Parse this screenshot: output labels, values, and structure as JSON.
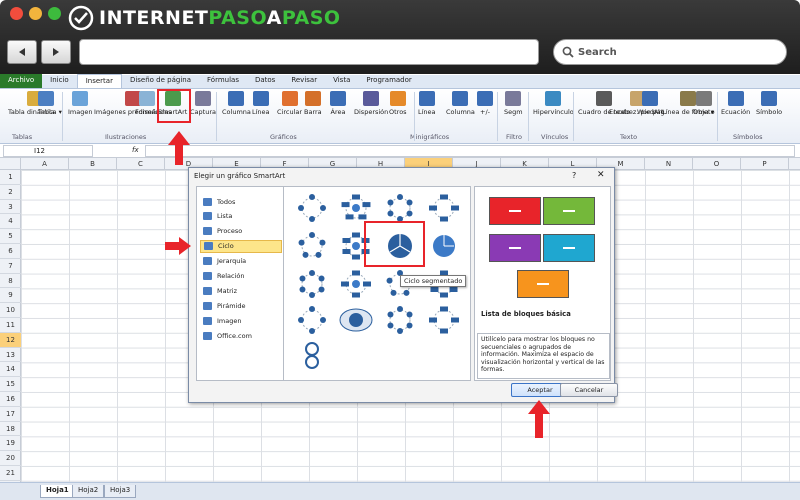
{
  "browser": {
    "logo_text_a": "INTERNET",
    "logo_text_b": "PASO",
    "logo_text_c": "A",
    "logo_text_d": "PASO",
    "search_label": "Search"
  },
  "ribbon": {
    "tabs": [
      "Archivo",
      "Inicio",
      "Insertar",
      "Diseño de página",
      "Fórmulas",
      "Datos",
      "Revisar",
      "Vista",
      "Programador"
    ],
    "buttons": [
      {
        "label": "Tabla dinámica ▾",
        "icon": "pivot-table-icon"
      },
      {
        "label": "Tabla",
        "icon": "table-icon"
      },
      {
        "label": "Imagen",
        "icon": "image-icon"
      },
      {
        "label": "Imágenes prediseñadas",
        "icon": "clipart-icon"
      },
      {
        "label": "Formas",
        "icon": "shapes-icon"
      },
      {
        "label": "SmartArt",
        "icon": "smartart-icon"
      },
      {
        "label": "Captura",
        "icon": "screenshot-icon"
      },
      {
        "label": "Columna",
        "icon": "column-chart-icon"
      },
      {
        "label": "Línea",
        "icon": "line-chart-icon"
      },
      {
        "label": "Circular",
        "icon": "pie-chart-icon"
      },
      {
        "label": "Barra",
        "icon": "bar-chart-icon"
      },
      {
        "label": "Área",
        "icon": "area-chart-icon"
      },
      {
        "label": "Dispersión",
        "icon": "scatter-chart-icon"
      },
      {
        "label": "Otros",
        "icon": "other-charts-icon"
      },
      {
        "label": "Línea",
        "icon": "sparkline-line-icon"
      },
      {
        "label": "Columna",
        "icon": "sparkline-column-icon"
      },
      {
        "label": "+/-",
        "icon": "sparkline-winloss-icon"
      },
      {
        "label": "Segm",
        "icon": "slicer-icon"
      },
      {
        "label": "Hipervínculo",
        "icon": "hyperlink-icon"
      },
      {
        "label": "Cuadro de texto",
        "icon": "textbox-icon"
      },
      {
        "label": "Encabez. pie pág.",
        "icon": "header-footer-icon"
      },
      {
        "label": "WordArt",
        "icon": "wordart-icon"
      },
      {
        "label": "Línea de firma ▾",
        "icon": "signature-line-icon"
      },
      {
        "label": "Objeto",
        "icon": "object-icon"
      },
      {
        "label": "Ecuación",
        "icon": "equation-icon"
      },
      {
        "label": "Símbolo",
        "icon": "symbol-icon"
      }
    ],
    "groups": [
      "Tablas",
      "Ilustraciones",
      "Gráficos",
      "Minigráficos",
      "Filtro",
      "Vínculos",
      "Texto",
      "Símbolos"
    ]
  },
  "formula_bar": {
    "name_box": "I12",
    "fx": "fx"
  },
  "columns": [
    "A",
    "B",
    "C",
    "D",
    "E",
    "F",
    "G",
    "H",
    "I",
    "J",
    "K",
    "L",
    "M",
    "N",
    "O",
    "P"
  ],
  "rows": [
    "1",
    "2",
    "3",
    "4",
    "5",
    "6",
    "7",
    "8",
    "9",
    "10",
    "11",
    "12",
    "13",
    "14",
    "15",
    "16",
    "17",
    "18",
    "19",
    "20",
    "21"
  ],
  "sheets": [
    "Hoja1",
    "Hoja2",
    "Hoja3"
  ],
  "dialog": {
    "title": "Elegir un gráfico SmartArt",
    "help": "?",
    "close": "✕",
    "categories": [
      "Todos",
      "Lista",
      "Proceso",
      "Ciclo",
      "Jerarquía",
      "Relación",
      "Matriz",
      "Pirámide",
      "Imagen",
      "Office.com"
    ],
    "selected_category": "Ciclo",
    "tooltip": "Ciclo segmentado",
    "preview_title": "Lista de bloques básica",
    "preview_description": "Utilícelo para mostrar los bloques no secuenciales o agrupados de información. Maximiza el espacio de visualización horizontal y vertical de las formas.",
    "ok_label": "Aceptar",
    "cancel_label": "Cancelar"
  },
  "colors": {
    "accent_red": "#e8242a",
    "excel_green": "#2a7a2a",
    "smartart_blue": "#2b5f9e"
  }
}
